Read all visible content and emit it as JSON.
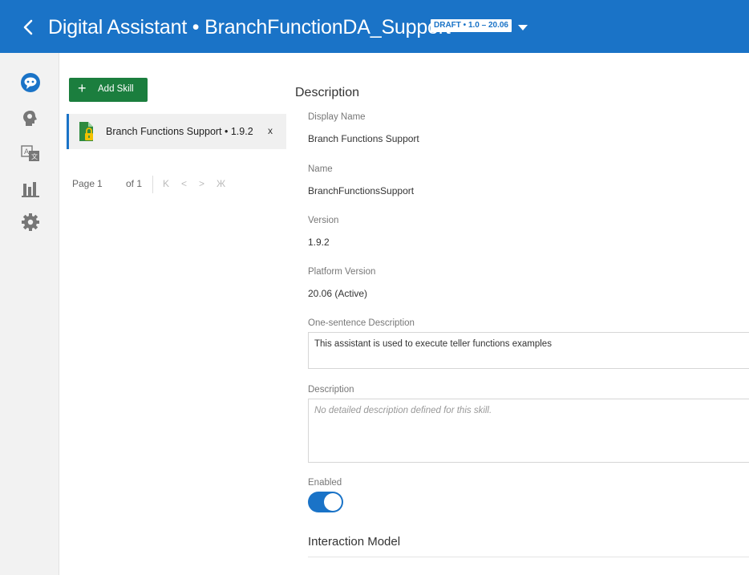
{
  "header": {
    "title": "Digital Assistant • BranchFunctionDA_Support",
    "badge": "DRAFT • 1.0 – 20.06",
    "bg_color": "#1a73c7"
  },
  "leftbar": {
    "icons": [
      "chat-bubble-icon",
      "head-bulb-icon",
      "translate-icon",
      "bar-chart-icon",
      "gear-icon"
    ]
  },
  "skills_panel": {
    "add_skill_label": "Add Skill",
    "skills": [
      {
        "name": "Branch Functions Support • 1.9.2",
        "close": "x"
      }
    ],
    "pager": {
      "label": "Page",
      "page": "1",
      "of": "of 1",
      "first": "K",
      "prev": "<",
      "next": ">",
      "last": "Ж"
    }
  },
  "detail": {
    "section_title": "Description",
    "display_name_label": "Display Name",
    "display_name_value": "Branch Functions Support",
    "name_label": "Name",
    "name_value": "BranchFunctionsSupport",
    "version_label": "Version",
    "version_value": "1.9.2",
    "platform_version_label": "Platform Version",
    "platform_version_value": "20.06 (Active)",
    "one_sentence_label": "One-sentence Description",
    "one_sentence_value": "This assistant is used to execute teller functions examples",
    "description_label": "Description",
    "description_placeholder": "No detailed description defined for this skill.",
    "enabled_label": "Enabled",
    "enabled": true,
    "interaction_model_title": "Interaction Model"
  }
}
